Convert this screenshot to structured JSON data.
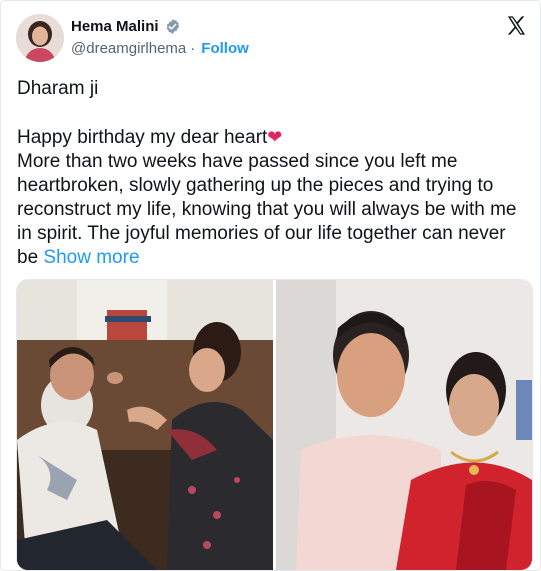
{
  "profile": {
    "display_name": "Hema Malini",
    "handle": "@dreamgirlhema",
    "separator": "·",
    "follow_label": "Follow"
  },
  "tweet": {
    "line1": "Dharam ji",
    "line2": "Happy birthday my dear heart",
    "line3": "More than two weeks have passed since you left me heartbroken, slowly gathering up the pieces and trying to reconstruct my life, knowing that you will always be with me in spirit. The joyful memories of our life together can never be",
    "show_more": "Show more"
  },
  "icons": {
    "verified": "verified-badge-icon",
    "platform": "x-logo-icon",
    "heart": "red-heart-emoji"
  },
  "colors": {
    "accent": "#1d9bf0",
    "text": "#0f1419",
    "muted": "#536471",
    "heart": "#e0245e"
  },
  "media": {
    "photos": [
      {
        "description_key": "photo-left"
      },
      {
        "description_key": "photo-right"
      }
    ]
  }
}
